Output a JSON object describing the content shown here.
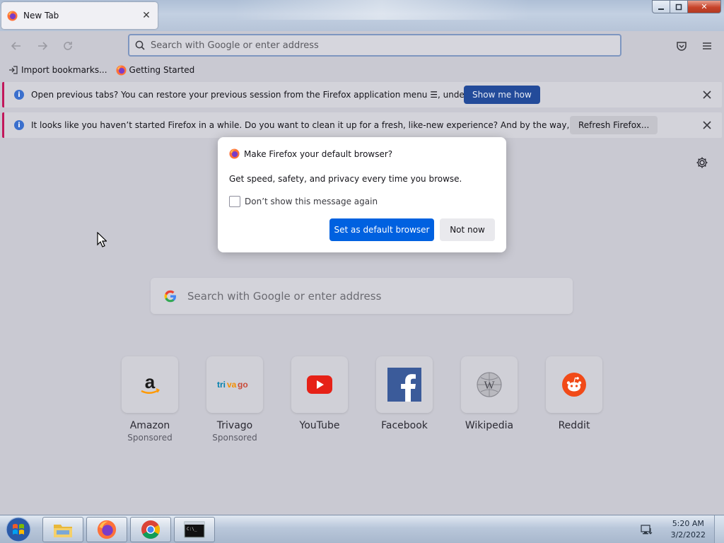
{
  "browser": {
    "tab_title": "New Tab",
    "url_placeholder": "Search with Google or enter address"
  },
  "bookmarks": [
    {
      "label": "Import bookmarks...",
      "icon": "import-icon"
    },
    {
      "label": "Getting Started",
      "icon": "firefox-icon"
    }
  ],
  "notifications": [
    {
      "text": "Open previous tabs? You can restore your previous session from the Firefox application menu ☰, under History.",
      "button": "Show me how"
    },
    {
      "text": "It looks like you haven’t started Firefox in a while. Do you want to clean it up for a fresh, like-new experience? And by the way, welcome back!",
      "button": "Refresh Firefox..."
    }
  ],
  "newtab": {
    "search_placeholder": "Search with Google or enter address",
    "shortcuts": [
      {
        "label": "Amazon",
        "sub": "Sponsored",
        "icon": "amazon-icon"
      },
      {
        "label": "Trivago",
        "sub": "Sponsored",
        "icon": "trivago-icon"
      },
      {
        "label": "YouTube",
        "sub": "",
        "icon": "youtube-icon"
      },
      {
        "label": "Facebook",
        "sub": "",
        "icon": "facebook-icon"
      },
      {
        "label": "Wikipedia",
        "sub": "",
        "icon": "wikipedia-icon"
      },
      {
        "label": "Reddit",
        "sub": "",
        "icon": "reddit-icon"
      }
    ]
  },
  "dialog": {
    "title": "Make Firefox your default browser?",
    "body": "Get speed, safety, and privacy every time you browse.",
    "checkbox_label": "Don’t show this message again",
    "primary_button": "Set as default browser",
    "secondary_button": "Not now"
  },
  "taskbar": {
    "time": "5:20 AM",
    "date": "3/2/2022"
  },
  "colors": {
    "primary_blue": "#0061e0",
    "notification_accent": "#c2185b"
  }
}
